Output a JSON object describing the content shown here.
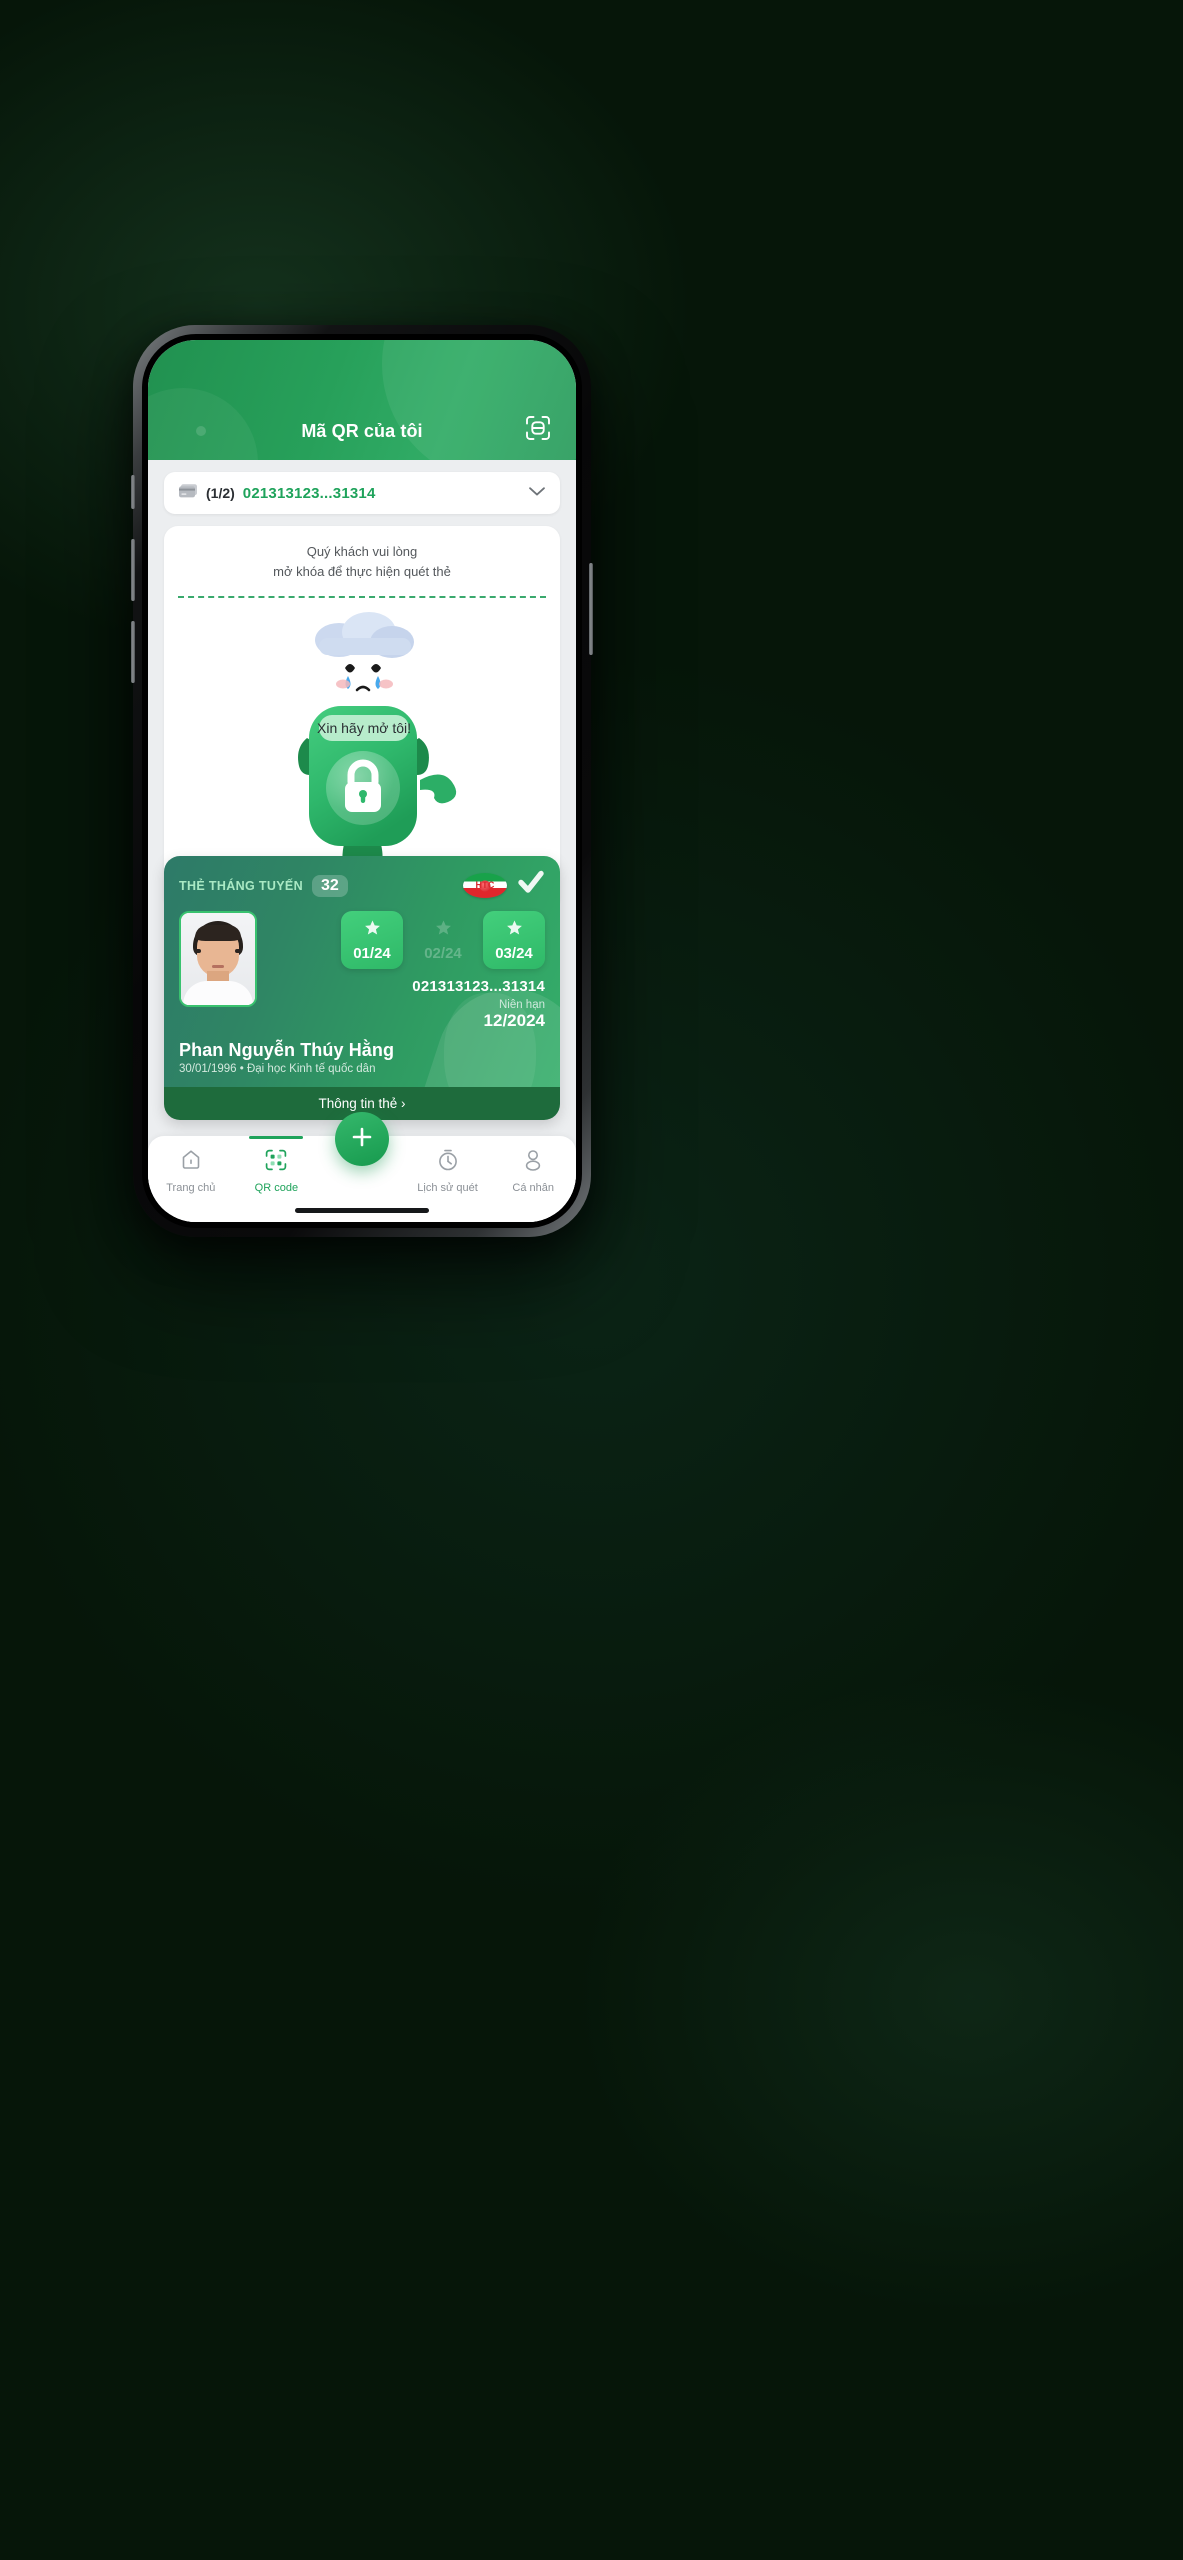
{
  "header": {
    "title": "Mã QR của tôi",
    "scan_icon": "qr-scan-icon"
  },
  "card_selector": {
    "card_icon": "card-icon",
    "count": "(1/2)",
    "code": "021313123...31314",
    "chevron_icon": "chevron-down-icon"
  },
  "qr_panel": {
    "note_line1": "Quý khách vui lòng",
    "note_line2": "mở khóa để thực hiện quét thẻ",
    "mascot": {
      "speech_bubble": "Xin hãy mở tôi!",
      "lock_icon": "lock-icon",
      "cloud_icon": "rain-cloud-icon",
      "face": "crying-face"
    }
  },
  "member_card": {
    "type_label": "THẺ THÁNG TUYẾN",
    "route_number": "32",
    "brand_logo_text": "HTC",
    "verified_icon": "check-icon",
    "months": [
      {
        "label": "01/24",
        "active": true,
        "icon": "star-icon"
      },
      {
        "label": "02/24",
        "active": false,
        "icon": "star-icon"
      },
      {
        "label": "03/24",
        "active": true,
        "icon": "star-icon"
      }
    ],
    "card_code": "021313123...31314",
    "expiry_label": "Niên hạn",
    "expiry_value": "12/2024",
    "holder_name": "Phan Nguyễn Thúy Hằng",
    "holder_sub": "30/01/1996 • Đại học Kinh tế quốc dân",
    "footer_label": "Thông tin thẻ ›",
    "avatar": "user-photo"
  },
  "bottom_nav": {
    "fab_icon": "plus-icon",
    "items": [
      {
        "label": "Trang chủ",
        "icon": "home-icon",
        "active": false
      },
      {
        "label": "QR code",
        "icon": "qr-code-icon",
        "active": true
      },
      {
        "label": "Lịch sử quét",
        "icon": "history-icon",
        "active": false
      },
      {
        "label": "Cá nhân",
        "icon": "person-icon",
        "active": false
      }
    ]
  },
  "colors": {
    "brand_green": "#1fa35b",
    "header_green": "#27a05a",
    "card_teal": "#2e7a68",
    "footer_green": "#1e6b3c",
    "background": "#06180e"
  }
}
